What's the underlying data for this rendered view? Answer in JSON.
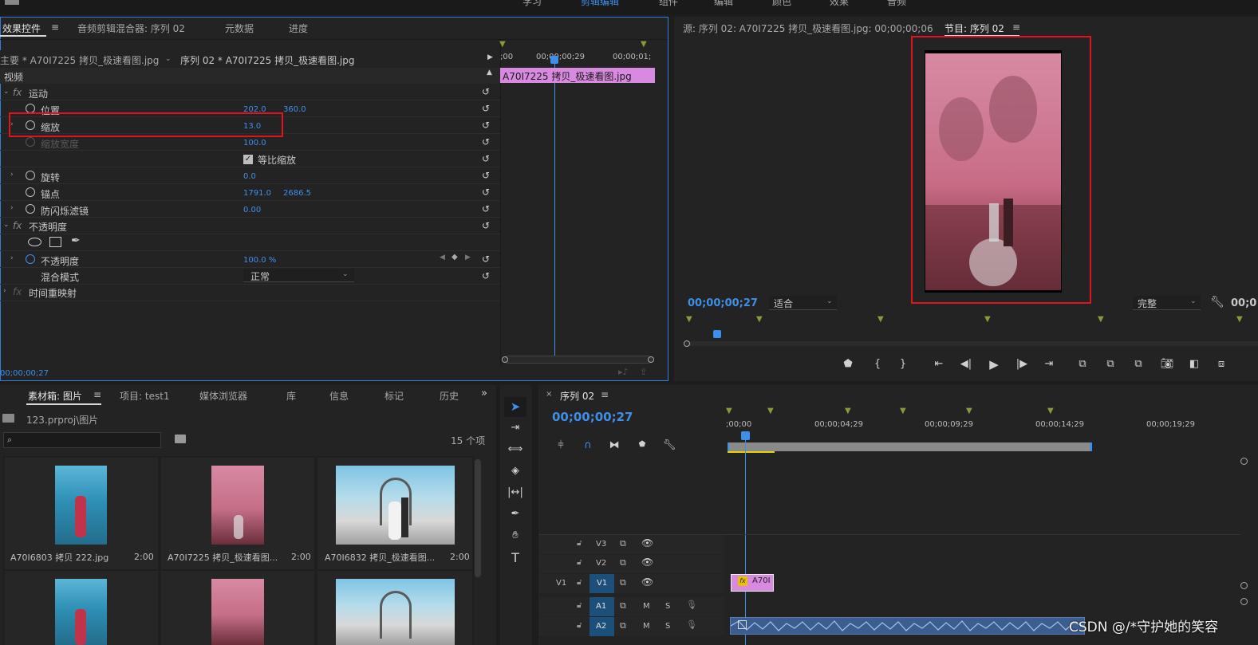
{
  "topbar": {
    "tabs": [
      "学习",
      "剪辑编辑",
      "组件",
      "编辑",
      "颜色",
      "效果",
      "音频"
    ]
  },
  "effect_panel": {
    "tabs": [
      "效果控件",
      "音频剪辑混合器: 序列 02",
      "元数据",
      "进度"
    ],
    "master": "主要 * A70I7225 拷贝_极速看图.jpg",
    "seq_clip": "序列 02 * A70I7225 拷贝_极速看图.jpg",
    "section": "视频",
    "motion": "运动",
    "rows": [
      {
        "label": "位置",
        "v1": "202.0",
        "v2": "360.0"
      },
      {
        "label": "缩放",
        "v1": "13.0",
        "v2": ""
      },
      {
        "label": "缩放宽度",
        "v1": "100.0",
        "v2": ""
      },
      {
        "label": "等比缩放",
        "v1": "",
        "v2": ""
      },
      {
        "label": "旋转",
        "v1": "0.0",
        "v2": ""
      },
      {
        "label": "锚点",
        "v1": "1791.0",
        "v2": "2686.5"
      },
      {
        "label": "防闪烁滤镜",
        "v1": "0.00",
        "v2": ""
      }
    ],
    "opacity_group": "不透明度",
    "opacity_label": "不透明度",
    "opacity_value": "100.0 %",
    "blend_label": "混合模式",
    "blend_value": "正常",
    "time_remap": "时间重映射",
    "timecode": "00;00;00;27",
    "mini_ruler": [
      ";00",
      "00;00;00;29",
      "00;00;01;"
    ],
    "clip_name": "A70I7225 拷贝_极速看图.jpg"
  },
  "source_panel": {
    "source_tab": "源: 序列 02: A70I7225 拷贝_极速看图.jpg: 00;00;00;06",
    "program_tab": "节目: 序列 02",
    "timecode": "00;00;00;27",
    "fit": "适合",
    "quality": "完整",
    "time_right": "00;0"
  },
  "bin_panel": {
    "tabs": [
      "素材箱: 图片",
      "项目: test1",
      "媒体浏览器",
      "库",
      "信息",
      "标记",
      "历史"
    ],
    "path": "123.prproj\\图片",
    "count": "15 个项",
    "items": [
      {
        "name": "A70I6803 拷贝 222.jpg",
        "dur": "2:00"
      },
      {
        "name": "A70I7225 拷贝_极速看图...",
        "dur": "2:00"
      },
      {
        "name": "A70I6832 拷贝_极速看图...",
        "dur": "2:00"
      }
    ]
  },
  "timeline": {
    "tab": "序列 02",
    "timecode": "00;00;00;27",
    "ruler": [
      ";00;00",
      "00;00;04;29",
      "00;00;09;29",
      "00;00;14;29",
      "00;00;19;29"
    ],
    "tracks": [
      "V3",
      "V2",
      "V1",
      "A1",
      "A2"
    ],
    "clip": "A70I",
    "track_left": "V1",
    "m": "M",
    "s": "S"
  },
  "watermark": "CSDN @/*守护她的笑容",
  "colors": {
    "accent": "#3e8fe8",
    "red": "#e0141a",
    "clip_pink": "#d88ae0",
    "audio_blue": "#6e8ec2"
  }
}
